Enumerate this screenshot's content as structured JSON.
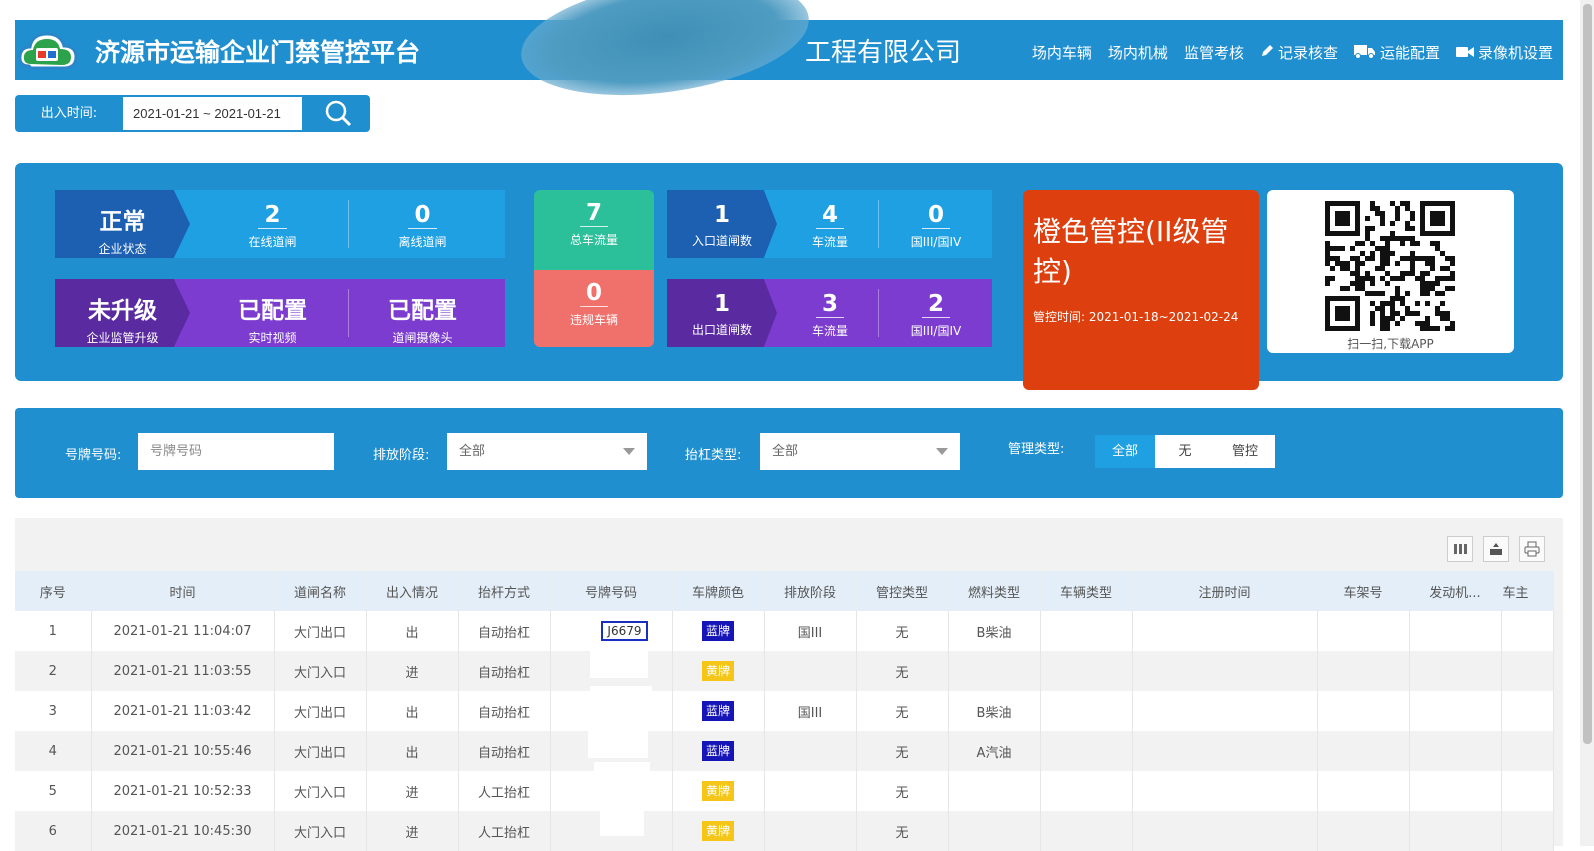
{
  "header": {
    "app_title": "济源市运输企业门禁管控平台",
    "company_visible": "工程有限公司",
    "nav": [
      {
        "label": "场内车辆",
        "icon": ""
      },
      {
        "label": "场内机械",
        "icon": ""
      },
      {
        "label": "监管考核",
        "icon": ""
      },
      {
        "label": "记录核查",
        "icon": "pencil-icon"
      },
      {
        "label": "运能配置",
        "icon": "truck-icon"
      },
      {
        "label": "录像机设置",
        "icon": "video-camera-icon"
      }
    ]
  },
  "date_filter": {
    "label": "出入时间:",
    "value": "2021-01-21 ~ 2021-01-21"
  },
  "dashboard": {
    "status": {
      "value": "正常",
      "label": "企业状态"
    },
    "online": {
      "value": "2",
      "label": "在线道闸"
    },
    "offline": {
      "value": "0",
      "label": "离线道闸"
    },
    "upgrade": {
      "value": "未升级",
      "label": "企业监管升级"
    },
    "video": {
      "value": "已配置",
      "label": "实时视频"
    },
    "camera": {
      "value": "已配置",
      "label": "道闸摄像头"
    },
    "total_flow": {
      "value": "7",
      "label": "总车流量"
    },
    "violations": {
      "value": "0",
      "label": "违规车辆"
    },
    "entry_gates": {
      "value": "1",
      "label": "入口道闸数"
    },
    "entry_flow": {
      "value": "4",
      "label": "车流量"
    },
    "entry_standard": {
      "value": "0",
      "label": "国III/国IV"
    },
    "exit_gates": {
      "value": "1",
      "label": "出口道闸数"
    },
    "exit_flow": {
      "value": "3",
      "label": "车流量"
    },
    "exit_standard": {
      "value": "2",
      "label": "国III/国IV"
    },
    "control": {
      "title": "橙色管控(II级管控)",
      "period": "管控时间: 2021-01-18~2021-02-24"
    },
    "qr": {
      "caption": "扫一扫,下载APP"
    }
  },
  "filters": {
    "plate_label": "号牌号码:",
    "plate_placeholder": "号牌号码",
    "emission_label": "排放阶段:",
    "emission_value": "全部",
    "barrier_label": "抬杠类型:",
    "barrier_value": "全部",
    "manage_label": "管理类型:",
    "manage_options": [
      "全部",
      "无",
      "管控"
    ],
    "manage_selected": "全部"
  },
  "table": {
    "columns": [
      "序号",
      "时间",
      "道闸名称",
      "出入情况",
      "抬杆方式",
      "号牌号码",
      "车牌颜色",
      "排放阶段",
      "管控类型",
      "燃料类型",
      "车辆类型",
      "注册时间",
      "车架号",
      "发动机...",
      "车主"
    ],
    "rows": [
      {
        "no": "1",
        "time": "2021-01-21 11:04:07",
        "gate": "大门出口",
        "dir": "出",
        "mode": "自动抬杠",
        "plate": "J6679",
        "color": "蓝牌",
        "emission": "国III",
        "control": "无",
        "fuel": "B柴油"
      },
      {
        "no": "2",
        "time": "2021-01-21 11:03:55",
        "gate": "大门入口",
        "dir": "进",
        "mode": "自动抬杠",
        "plate": "",
        "color": "黄牌",
        "emission": "",
        "control": "无",
        "fuel": ""
      },
      {
        "no": "3",
        "time": "2021-01-21 11:03:42",
        "gate": "大门出口",
        "dir": "出",
        "mode": "自动抬杠",
        "plate": "",
        "color": "蓝牌",
        "emission": "国III",
        "control": "无",
        "fuel": "B柴油"
      },
      {
        "no": "4",
        "time": "2021-01-21 10:55:46",
        "gate": "大门出口",
        "dir": "出",
        "mode": "自动抬杠",
        "plate": "",
        "color": "蓝牌",
        "emission": "",
        "control": "无",
        "fuel": "A汽油"
      },
      {
        "no": "5",
        "time": "2021-01-21 10:52:33",
        "gate": "大门入口",
        "dir": "进",
        "mode": "人工抬杠",
        "plate": "",
        "color": "黄牌",
        "emission": "",
        "control": "无",
        "fuel": ""
      },
      {
        "no": "6",
        "time": "2021-01-21 10:45:30",
        "gate": "大门入口",
        "dir": "进",
        "mode": "人工抬杠",
        "plate": "",
        "color": "黄牌",
        "emission": "",
        "control": "无",
        "fuel": ""
      }
    ]
  },
  "colors": {
    "primary": "#1f8fd0",
    "status_dark": "#1d5fb0",
    "purple": "#7b3ccf",
    "purple_dark": "#5a2aa0",
    "teal": "#2bbf9a",
    "red_soft": "#f0706b",
    "orange": "#dd3f0e",
    "plate_blue": "#1515b8",
    "plate_yellow": "#f5c518"
  }
}
